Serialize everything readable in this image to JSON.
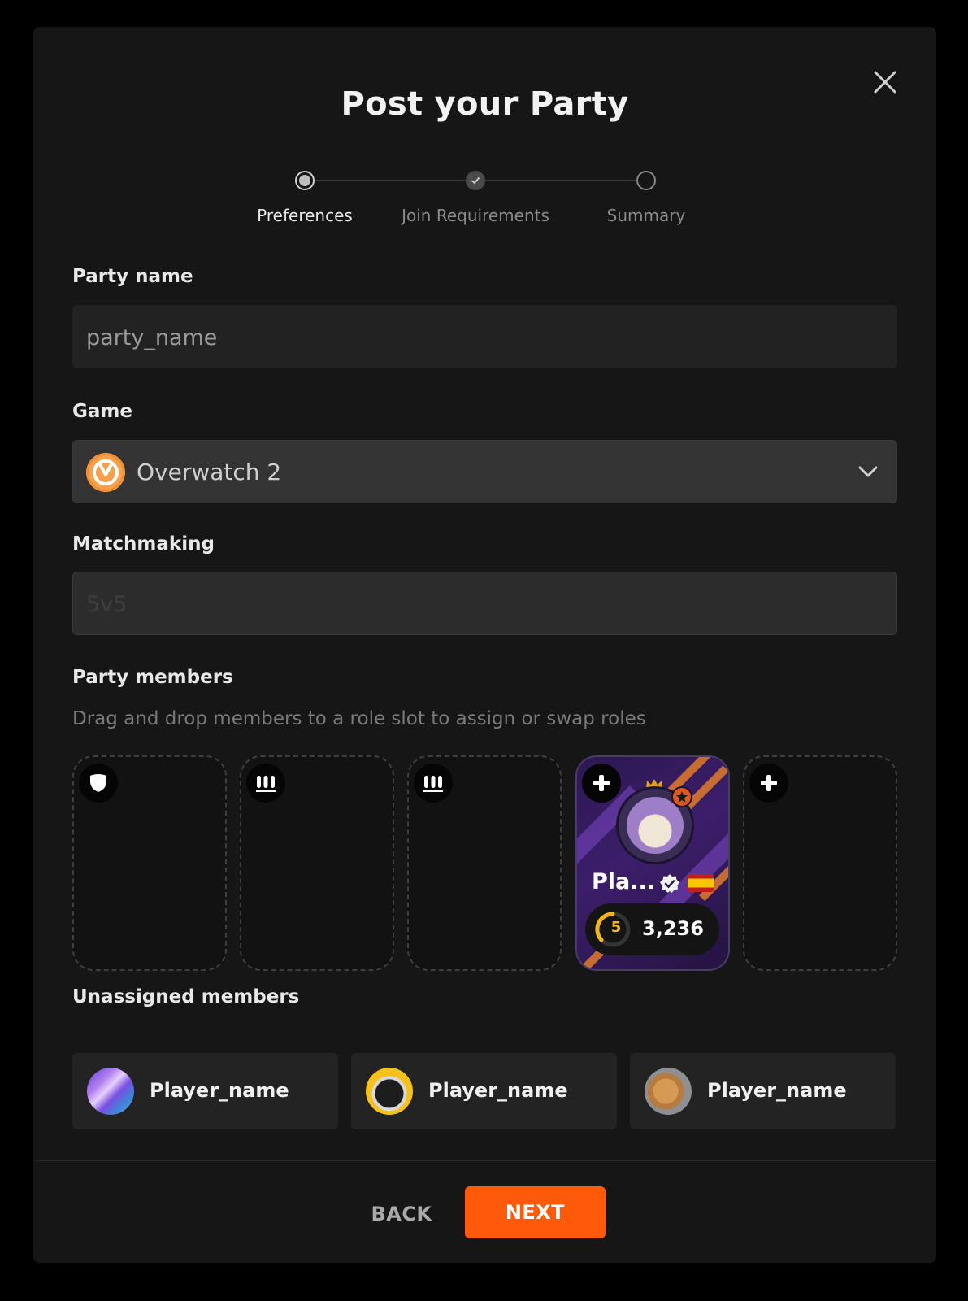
{
  "modal": {
    "title": "Post your Party",
    "close_icon": "close-icon"
  },
  "stepper": {
    "steps": [
      {
        "label": "Preferences",
        "state": "active"
      },
      {
        "label": "Join Requirements",
        "state": "completed"
      },
      {
        "label": "Summary",
        "state": "upcoming"
      }
    ]
  },
  "form": {
    "party_name": {
      "label": "Party name",
      "placeholder": "party_name",
      "value": ""
    },
    "game": {
      "label": "Game",
      "value": "Overwatch 2",
      "icon": "overwatch-icon"
    },
    "matchmaking": {
      "label": "Matchmaking",
      "value": "5v5",
      "disabled": true
    }
  },
  "party_members": {
    "label": "Party members",
    "hint": "Drag and drop members to a role slot to assign or swap roles",
    "slots": [
      {
        "role": "tank",
        "icon": "shield-icon",
        "empty": true
      },
      {
        "role": "damage",
        "icon": "ammo-icon",
        "empty": true
      },
      {
        "role": "damage",
        "icon": "ammo-icon",
        "empty": true
      },
      {
        "role": "flex",
        "icon": "plus-icon",
        "empty": false,
        "player": {
          "name": "Pla...",
          "level": "5",
          "rating": "3,236",
          "verified": true,
          "flag": "spain-flag",
          "leader": true
        }
      },
      {
        "role": "flex",
        "icon": "plus-icon",
        "empty": true
      }
    ]
  },
  "unassigned": {
    "label": "Unassigned members",
    "members": [
      {
        "name": "Player_name",
        "avatar": "abstract-purple-avatar"
      },
      {
        "name": "Player_name",
        "avatar": "pug-avatar"
      },
      {
        "name": "Player_name",
        "avatar": "cat-avatar"
      }
    ]
  },
  "footer": {
    "back_label": "BACK",
    "next_label": "NEXT",
    "accent": "#ff5a0a"
  }
}
